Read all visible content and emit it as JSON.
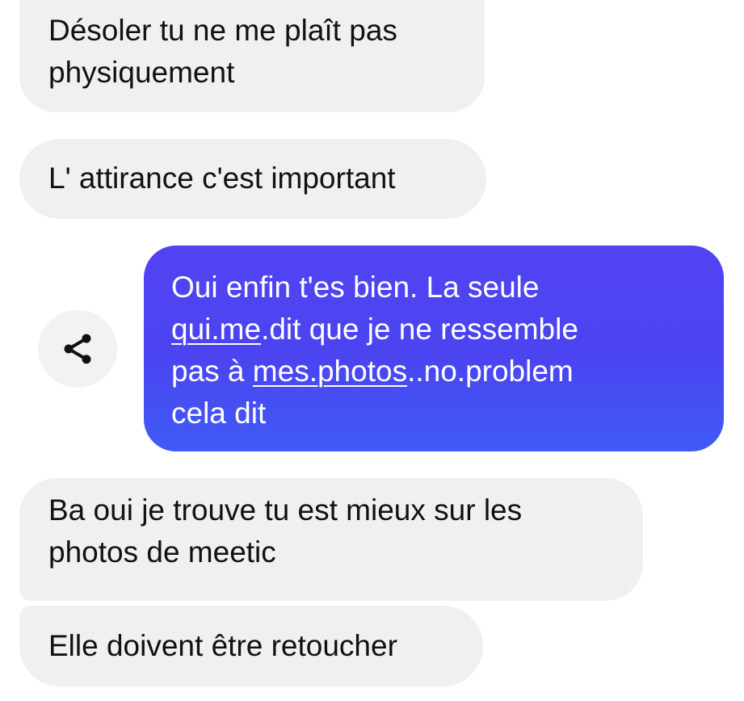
{
  "conversation": {
    "messages": [
      {
        "direction": "incoming",
        "lines": [
          "Désoler tu ne me plaît pas",
          "physiquement"
        ]
      },
      {
        "direction": "incoming",
        "lines": [
          "L' attirance c'est important"
        ]
      },
      {
        "direction": "outgoing",
        "line1": "Oui enfin t'es bien. La seule",
        "line2_link": "qui.me",
        "line2_rest": ".dit que je ne ressemble",
        "line3_pre": "pas à ",
        "line3_link": "mes.photos",
        "line3_rest": "..no.problem",
        "line4": "cela dit"
      },
      {
        "direction": "incoming",
        "lines": [
          "Ba oui je trouve tu est mieux sur les",
          "photos de meetic"
        ]
      },
      {
        "direction": "incoming",
        "lines": [
          "Elle doivent être retoucher"
        ]
      }
    ],
    "share_icon": "share-icon"
  },
  "colors": {
    "incoming_bubble": "#f0f0f0",
    "outgoing_bubble": "#4b44f1",
    "incoming_text": "#111111",
    "outgoing_text": "#ffffff"
  }
}
